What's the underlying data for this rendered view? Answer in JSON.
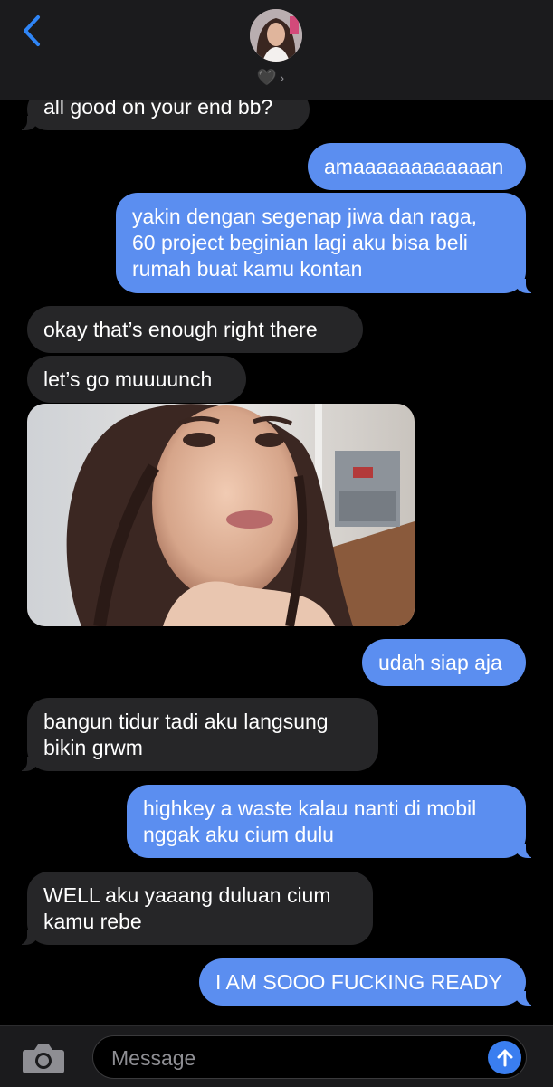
{
  "header": {
    "back_icon": "chevron-left-icon",
    "contact_name": "🖤",
    "contact_chevron": "›"
  },
  "messages": [
    {
      "direction": "incoming",
      "text": "all good on your end bb?"
    },
    {
      "direction": "outgoing",
      "text": "amaaaaaaaaaaaan"
    },
    {
      "direction": "outgoing",
      "lines": [
        "yakin dengan segenap jiwa dan raga,",
        "60 project beginian lagi aku bisa beli",
        "rumah buat kamu kontan"
      ]
    },
    {
      "direction": "incoming",
      "text": "okay that’s enough right there"
    },
    {
      "direction": "incoming",
      "text": "let’s go muuuunch"
    },
    {
      "direction": "incoming",
      "type": "photo",
      "description_icon": "photo-attachment"
    },
    {
      "direction": "outgoing",
      "text": "udah siap aja"
    },
    {
      "direction": "incoming",
      "lines": [
        "bangun tidur tadi aku langsung",
        "bikin grwm"
      ]
    },
    {
      "direction": "outgoing",
      "lines": [
        "highkey a waste kalau nanti di mobil",
        "nggak aku cium dulu"
      ]
    },
    {
      "direction": "incoming",
      "lines": [
        "WELL aku yaaang duluan cium",
        "kamu rebe"
      ]
    },
    {
      "direction": "outgoing",
      "text": "I AM SOOO FUCKING READY"
    }
  ],
  "composer": {
    "placeholder": "Message",
    "camera_icon": "camera-icon",
    "send_icon": "arrow-up-icon"
  },
  "colors": {
    "outgoing_bubble": "#5b8ef0",
    "incoming_bubble": "#262628",
    "background": "#000000",
    "accent": "#3a7ef0"
  }
}
